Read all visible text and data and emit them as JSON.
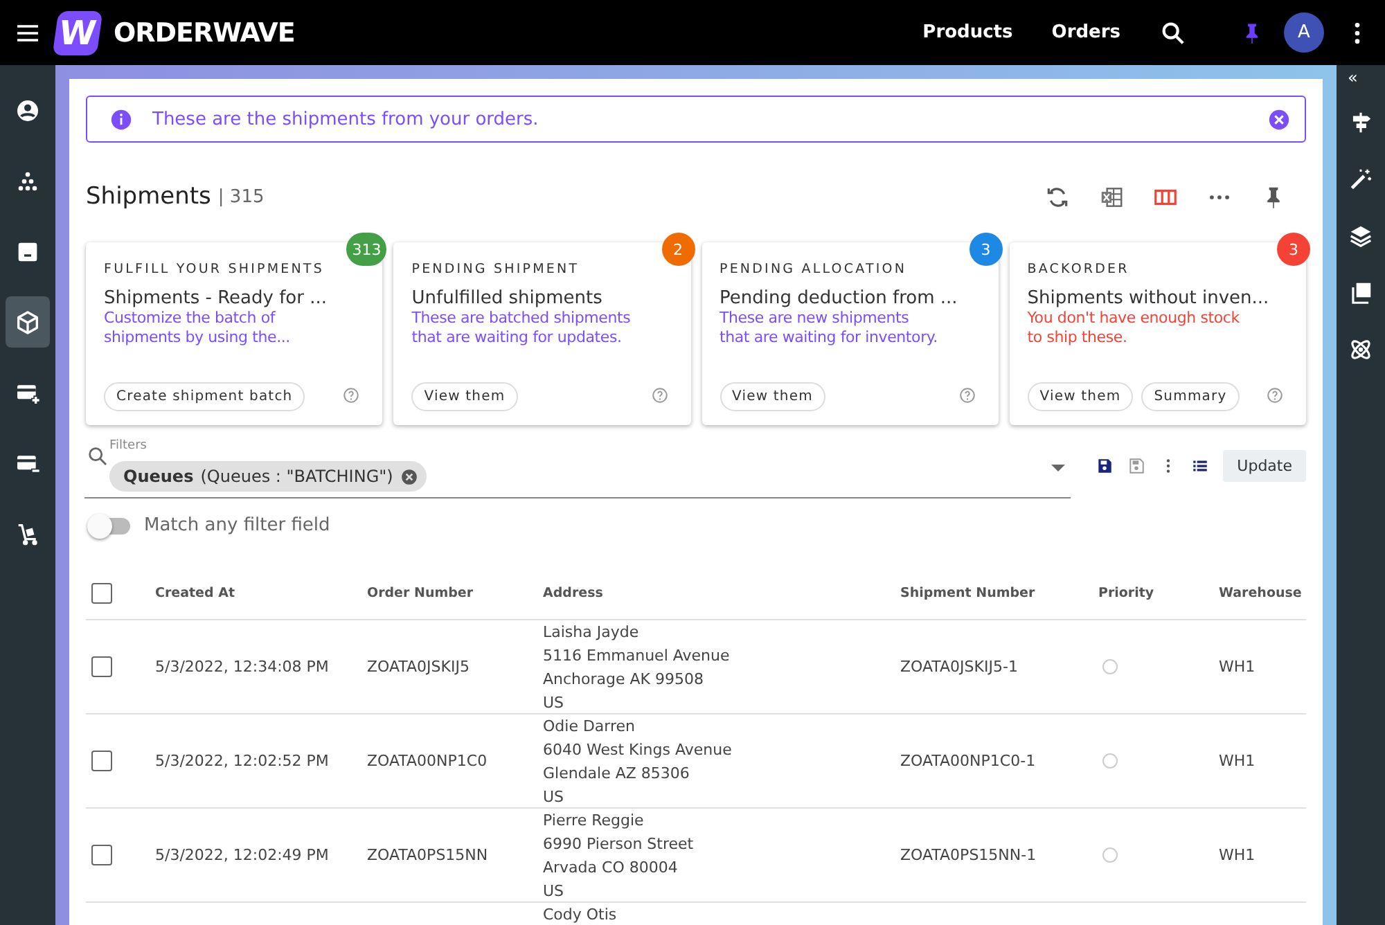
{
  "topbar": {
    "logo_letter": "W",
    "brand": "ORDERWAVE",
    "nav": [
      "Products",
      "Orders"
    ],
    "avatar": "A"
  },
  "sidebar": {
    "items": [
      {
        "selected": false
      },
      {
        "selected": false
      },
      {
        "selected": false
      },
      {
        "selected": true
      },
      {
        "selected": false
      },
      {
        "selected": false
      },
      {
        "selected": false
      }
    ]
  },
  "right_bar": {
    "collapse": "«"
  },
  "alert": {
    "text": "These are the shipments from your orders."
  },
  "header": {
    "title": "Shipments",
    "count": "| 315"
  },
  "cards": [
    {
      "title": "FULFILL YOUR SHIPMENTS",
      "badge": "313",
      "color": "#43a047",
      "heading": "Shipments - Ready for ...",
      "desc": [
        "Customize the batch of",
        "shipments by using the..."
      ],
      "warning": false,
      "buttons": [
        "Create shipment batch"
      ]
    },
    {
      "title": "PENDING SHIPMENT",
      "badge": "2",
      "color": "#ef6c00",
      "heading": "Unfulfilled shipments",
      "desc": [
        "These are batched shipments",
        "that are waiting for updates."
      ],
      "warning": false,
      "buttons": [
        "View them"
      ]
    },
    {
      "title": "PENDING ALLOCATION",
      "badge": "3",
      "color": "#1e88e5",
      "heading": "Pending deduction from ...",
      "desc": [
        "These are new shipments",
        "that are waiting for inventory."
      ],
      "warning": false,
      "buttons": [
        "View them"
      ]
    },
    {
      "title": "BACKORDER",
      "badge": "3",
      "color": "#f44336",
      "heading": "Shipments without inven...",
      "desc": [
        "You don't have enough stock",
        "to ship these."
      ],
      "warning": true,
      "buttons": [
        "View them",
        "Summary"
      ]
    }
  ],
  "filters": {
    "label": "Filters",
    "chip_name": "Queues",
    "chip_value": "(Queues : \"BATCHING\")",
    "update": "Update"
  },
  "match_toggle": {
    "label": "Match any filter field",
    "on": false
  },
  "table": {
    "all_checked": false,
    "columns": [
      "Created At",
      "Order Number",
      "Address",
      "Shipment Number",
      "Priority",
      "Warehouse"
    ],
    "rows": [
      {
        "created": "5/3/2022, 12:34:08 PM",
        "order": "ZOATA0JSKIJ5",
        "address": [
          "Laisha Jayde",
          "5116 Emmanuel Avenue",
          "Anchorage AK 99508",
          "US"
        ],
        "shipment": "ZOATA0JSKIJ5-1",
        "warehouse": "WH1",
        "checked": false
      },
      {
        "created": "5/3/2022, 12:02:52 PM",
        "order": "ZOATA00NP1C0",
        "address": [
          "Odie Darren",
          "6040 West Kings Avenue",
          "Glendale AZ 85306",
          "US"
        ],
        "shipment": "ZOATA00NP1C0-1",
        "warehouse": "WH1",
        "checked": false
      },
      {
        "created": "5/3/2022, 12:02:49 PM",
        "order": "ZOATA0PS15NN",
        "address": [
          "Pierre Reggie",
          "6990 Pierson Street",
          "Arvada CO 80004",
          "US"
        ],
        "shipment": "ZOATA0PS15NN-1",
        "warehouse": "WH1",
        "checked": false
      },
      {
        "address": [
          "Cody Otis"
        ]
      }
    ]
  }
}
